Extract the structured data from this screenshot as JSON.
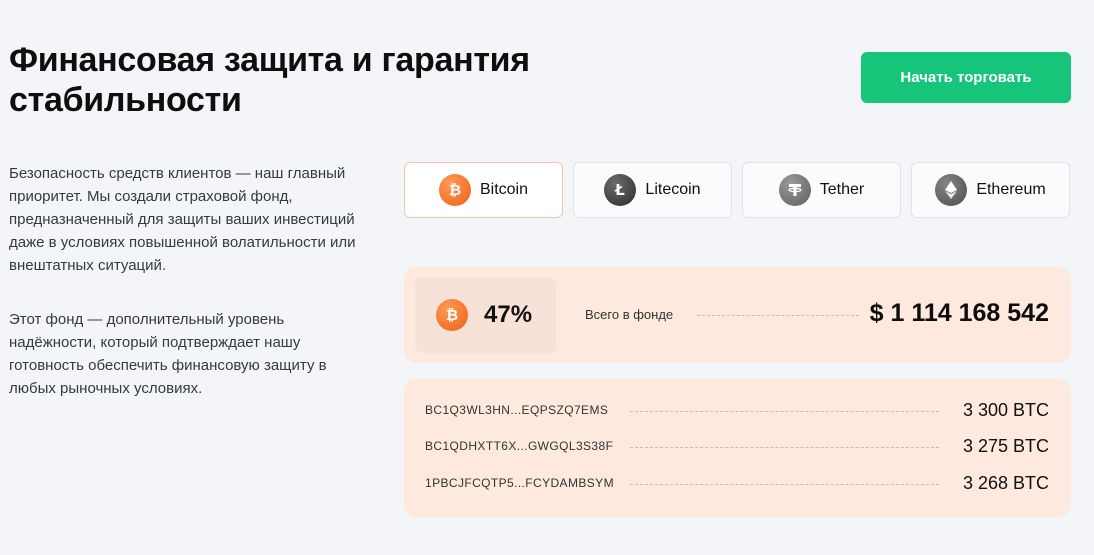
{
  "header": {
    "title": "Финансовая защита и гарантия стабильности",
    "cta_label": "Начать торговать"
  },
  "description": {
    "p1": "Безопасность средств клиентов — наш главный приоритет. Мы создали страховой фонд, предназначенный для защиты ваших инвестиций даже в условиях повышенной волатильности или внештатных ситуаций.",
    "p2": "Этот фонд — дополнительный уровень надёжности, который подтверждает нашу готовность обеспечить финансовую защиту в любых рыночных условиях."
  },
  "tabs": [
    {
      "label": "Bitcoin",
      "icon": "bitcoin-icon",
      "active": true
    },
    {
      "label": "Litecoin",
      "icon": "litecoin-icon",
      "active": false
    },
    {
      "label": "Tether",
      "icon": "tether-icon",
      "active": false
    },
    {
      "label": "Ethereum",
      "icon": "ethereum-icon",
      "active": false
    }
  ],
  "fund": {
    "percent": "47%",
    "label": "Всего в фонде",
    "amount": "$ 1 114 168 542",
    "icon": "bitcoin-icon"
  },
  "wallets": [
    {
      "address": "BC1Q3WL3HN...EQPSZQ7EMS",
      "value": "3 300 BTC"
    },
    {
      "address": "BC1QDHXTT6X...GWGQL3S38F",
      "value": "3 275 BTC"
    },
    {
      "address": "1PBCJFCQTP5...FCYDAMBSYM",
      "value": "3 268 BTC"
    }
  ],
  "colors": {
    "accent": "#16c47a",
    "panel": "#fde9de",
    "bitcoin": "#ef5f17",
    "background": "#f4f5f9"
  }
}
